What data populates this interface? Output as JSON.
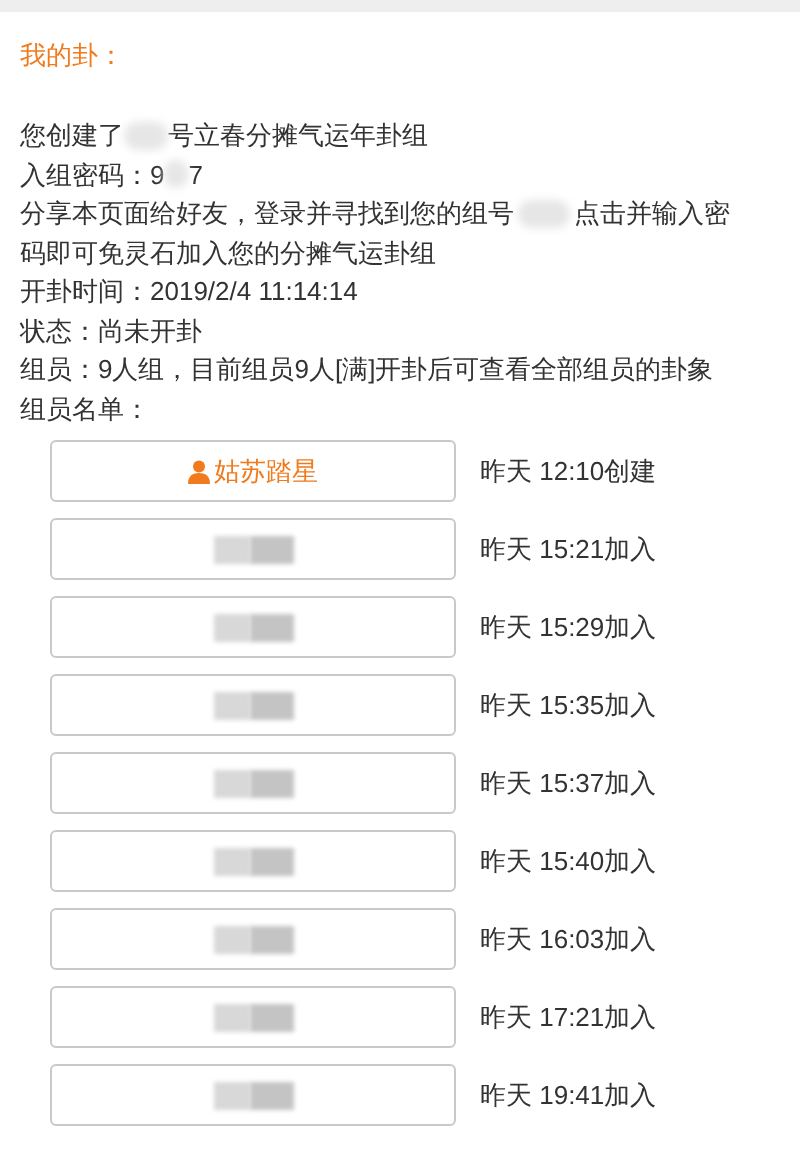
{
  "heading": "我的卦：",
  "created": {
    "before": "您创建了",
    "after": "号立春分摊气运年卦组"
  },
  "password": {
    "label": "入组密码：",
    "start": "9",
    "end": "7"
  },
  "share": {
    "before": "分享本页面给好友，登录并寻找到您的组号",
    "after": [
      "点击并输入密",
      "码即可免灵石加入您的分摊气运卦组"
    ]
  },
  "lines": [
    "开卦时间：2019/2/4 11:14:14",
    "状态：尚未开卦",
    "组员：9人组，目前组员9人[满]开卦后可查看全部组员的卦象",
    "组员名单："
  ],
  "members": [
    {
      "kind": "creator",
      "name": "姑苏踏星",
      "time": "昨天 12:10创建"
    },
    {
      "kind": "hidden",
      "time": "昨天 15:21加入"
    },
    {
      "kind": "hidden",
      "time": "昨天 15:29加入"
    },
    {
      "kind": "hidden",
      "time": "昨天 15:35加入"
    },
    {
      "kind": "hidden",
      "time": "昨天 15:37加入"
    },
    {
      "kind": "hidden",
      "time": "昨天 15:40加入"
    },
    {
      "kind": "hidden",
      "time": "昨天 16:03加入"
    },
    {
      "kind": "hidden",
      "time": "昨天 17:21加入"
    },
    {
      "kind": "hidden",
      "time": "昨天 19:41加入"
    }
  ]
}
